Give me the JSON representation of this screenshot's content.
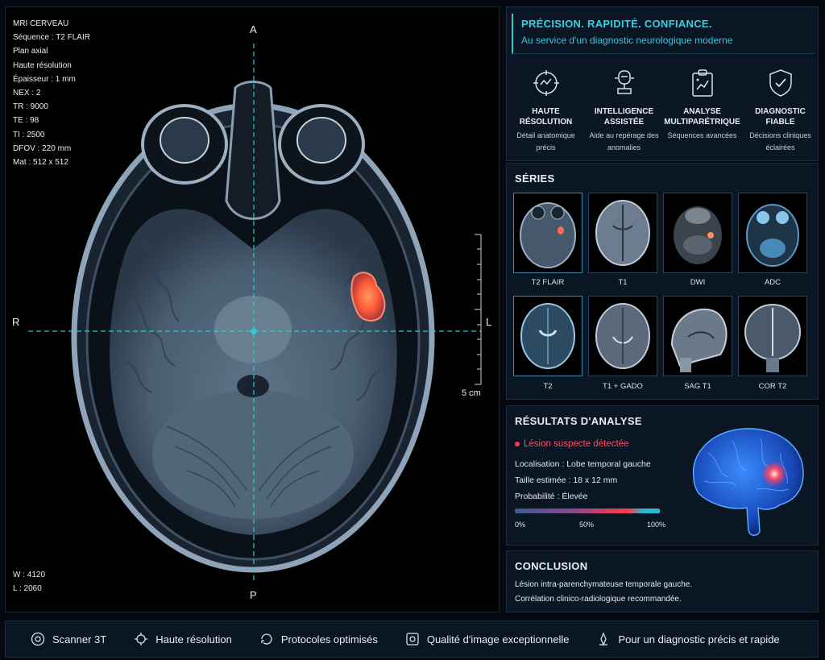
{
  "viewer": {
    "metadata": [
      "MRI CERVEAU",
      "Séquence : T2 FLAIR",
      "Plan axial",
      "Haute résolution",
      "Épaisseur : 1 mm",
      "NEX : 2",
      "TR : 9000",
      "TE : 98",
      "TI : 2500",
      "DFOV : 220 mm",
      "Mat : 512 x 512"
    ],
    "orientation": {
      "top": "A",
      "bottom": "P",
      "left": "R",
      "right": "L"
    },
    "scale_label": "5 cm",
    "window": "W : 4120",
    "level": "L : 2060"
  },
  "header": {
    "title": "PRÉCISION. RAPIDITÉ. CONFIANCE.",
    "subtitle": "Au service d'un diagnostic neurologique moderne"
  },
  "features": [
    {
      "icon": "target-scan-icon",
      "title": "HAUTE RÉSOLUTION",
      "subtitle": "Détail anatomique précis"
    },
    {
      "icon": "ai-assistant-icon",
      "title": "INTELLIGENCE ASSISTÉE",
      "subtitle": "Aide au repérage des anomalies"
    },
    {
      "icon": "clipboard-analysis-icon",
      "title": "ANALYSE MULTIPARÉTRIQUE",
      "subtitle": "Séquences avancées"
    },
    {
      "icon": "shield-check-icon",
      "title": "DIAGNOSTIC FIABLE",
      "subtitle": "Décisions cliniques éclairées"
    }
  ],
  "series": {
    "title": "SÉRIES",
    "items": [
      "T2 FLAIR",
      "T1",
      "DWI",
      "ADC",
      "T2",
      "T1 + GADO",
      "SAG T1",
      "COR T2"
    ]
  },
  "results": {
    "title": "RÉSULTATS D'ANALYSE",
    "alert": "Lésion suspecte détectée",
    "location": "Localisation : Lobe temporal gauche",
    "size": "Taille estimée : 18 x 12 mm",
    "probability": "Probabilité : Élevée",
    "probability_value": 0.88,
    "scale": [
      "0%",
      "50%",
      "100%"
    ]
  },
  "conclusion": {
    "title": "CONCLUSION",
    "lines": [
      "Lésion intra-parenchymateuse temporale gauche.",
      "Corrélation clinico-radiologique recommandée."
    ]
  },
  "footer": [
    {
      "icon": "scanner-icon",
      "label": "Scanner 3T"
    },
    {
      "icon": "resolution-icon",
      "label": "Haute résolution"
    },
    {
      "icon": "protocol-icon",
      "label": "Protocoles optimisés"
    },
    {
      "icon": "image-quality-icon",
      "label": "Qualité d'image exceptionnelle"
    },
    {
      "icon": "diagnostic-icon",
      "label": "Pour un diagnostic précis et rapide"
    }
  ],
  "colors": {
    "accent": "#2fd3e6",
    "alert": "#ff4e5c",
    "panel": "#0a1624"
  }
}
